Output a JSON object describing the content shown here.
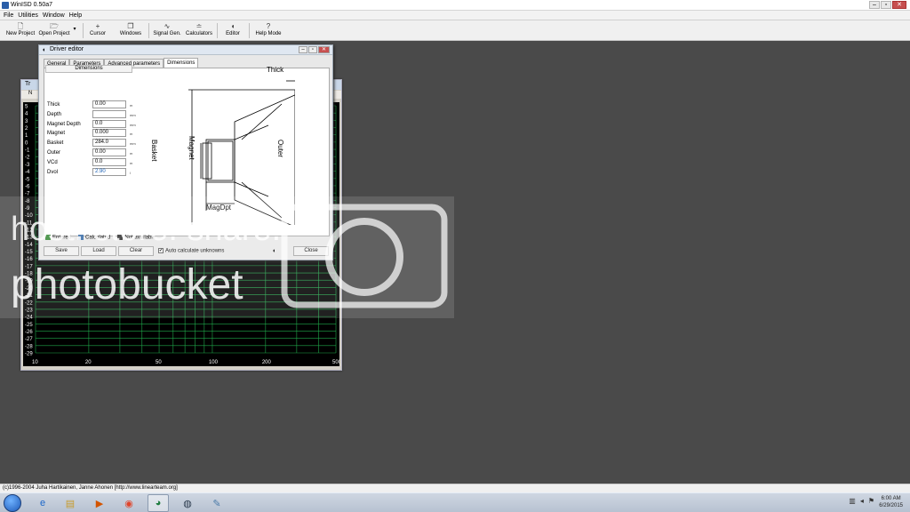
{
  "app": {
    "title": "WinISD 0.50a7"
  },
  "menu": [
    "File",
    "Utilities",
    "Window",
    "Help"
  ],
  "toolbar": {
    "new_project": "New Project",
    "open_project": "Open Project",
    "cursor": "Cursor",
    "windows": "Windows",
    "signal_gen": "Signal Gen.",
    "calculators": "Calculators",
    "editor": "Editor",
    "help_mode": "Help Mode"
  },
  "graph_window": {
    "title": "Tr",
    "toolbar_label": "N",
    "y_ticks": [
      "5",
      "4",
      "3",
      "2",
      "1",
      "0",
      "-1",
      "-2",
      "-3",
      "-4",
      "-5",
      "-6",
      "-7",
      "-8",
      "-9",
      "-10",
      "-11",
      "-12",
      "-13",
      "-14",
      "-15",
      "-16",
      "-17",
      "-18",
      "-19",
      "-20",
      "-21",
      "-22",
      "-23",
      "-24",
      "-25",
      "-26",
      "-27",
      "-28",
      "-29"
    ],
    "x_ticks": [
      "10",
      "20",
      "50",
      "100",
      "200",
      "500"
    ]
  },
  "editor": {
    "title": "Driver editor",
    "tabs": [
      "General",
      "Parameters",
      "Advanced parameters",
      "Dimensions"
    ],
    "active_tab": "Dimensions",
    "section_header": "Dimensions",
    "fields": [
      {
        "label": "Thick",
        "value": "0.00",
        "unit": "m"
      },
      {
        "label": "Depth",
        "value": "",
        "unit": "mm"
      },
      {
        "label": "Magnet Depth",
        "value": "0.0",
        "unit": "mm"
      },
      {
        "label": "Magnet",
        "value": "0.000",
        "unit": "m"
      },
      {
        "label": "Basket",
        "value": "284.0",
        "unit": "mm"
      },
      {
        "label": "Outer",
        "value": "0.00",
        "unit": "m"
      },
      {
        "label": "VCd",
        "value": "0.0",
        "unit": "m"
      },
      {
        "label": "Dvol",
        "value": "2.90",
        "unit": "l"
      }
    ],
    "diagram_labels": {
      "thick": "Thick",
      "basket": "Basket",
      "magnet": "Magnet",
      "outer": "Outer",
      "magdpt": "MagDpt",
      "depth": "Depth"
    },
    "legend": [
      "Entered",
      "Calculated",
      "Not available"
    ],
    "legend_colors": [
      "#3a8a3a",
      "#3a6ea8",
      "#333333"
    ],
    "buttons": {
      "save": "Save",
      "load": "Load",
      "clear": "Clear",
      "close": "Close"
    },
    "auto_calc": "Auto calculate unknowns",
    "auto_calc_mark": "✔"
  },
  "watermark": {
    "line1": "host. store. share.",
    "line2": "photobucket"
  },
  "status": "(c)1996-2004 Juha Hartikainen, Janne Ahonen [http://www.linearteam.org]",
  "taskbar": {
    "apps": [
      "ie-icon",
      "explorer-icon",
      "media-player-icon",
      "chrome-icon",
      "winisd-icon",
      "app-icon",
      "paint-icon"
    ],
    "time": "6:00 AM",
    "date": "6/29/2015"
  },
  "colors": {
    "grid": "#1fa84a",
    "plot_bg": "#000000",
    "desktop": "#4a4a4a"
  }
}
